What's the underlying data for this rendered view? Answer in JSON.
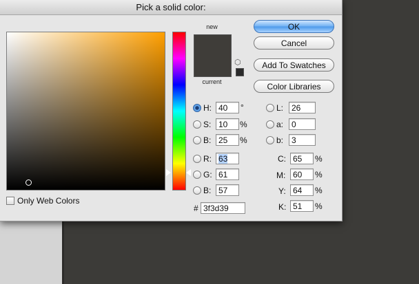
{
  "dialog": {
    "title": "Pick a solid color:"
  },
  "preview": {
    "new_label": "new",
    "current_label": "current",
    "new_color": "#3f3d39",
    "current_color": "#3f3d39",
    "cube_icon": "web-safe-cube-icon"
  },
  "buttons": {
    "ok": "OK",
    "cancel": "Cancel",
    "add_to_swatches": "Add To Swatches",
    "color_libraries": "Color Libraries"
  },
  "hsb": {
    "h": {
      "label": "H:",
      "value": "40",
      "unit": "°",
      "selected": true
    },
    "s": {
      "label": "S:",
      "value": "10",
      "unit": "%"
    },
    "b": {
      "label": "B:",
      "value": "25",
      "unit": "%"
    }
  },
  "rgb": {
    "r": {
      "label": "R:",
      "value": "63"
    },
    "g": {
      "label": "G:",
      "value": "61"
    },
    "b": {
      "label": "B:",
      "value": "57"
    }
  },
  "lab": {
    "l": {
      "label": "L:",
      "value": "26"
    },
    "a": {
      "label": "a:",
      "value": "0"
    },
    "b": {
      "label": "b:",
      "value": "3"
    }
  },
  "cmyk": {
    "c": {
      "label": "C:",
      "value": "65",
      "unit": "%"
    },
    "m": {
      "label": "M:",
      "value": "60",
      "unit": "%"
    },
    "y": {
      "label": "Y:",
      "value": "64",
      "unit": "%"
    },
    "k": {
      "label": "K:",
      "value": "51",
      "unit": "%"
    }
  },
  "hex": {
    "label": "#",
    "value": "3f3d39"
  },
  "web_colors": {
    "label": "Only Web Colors",
    "checked": false
  }
}
